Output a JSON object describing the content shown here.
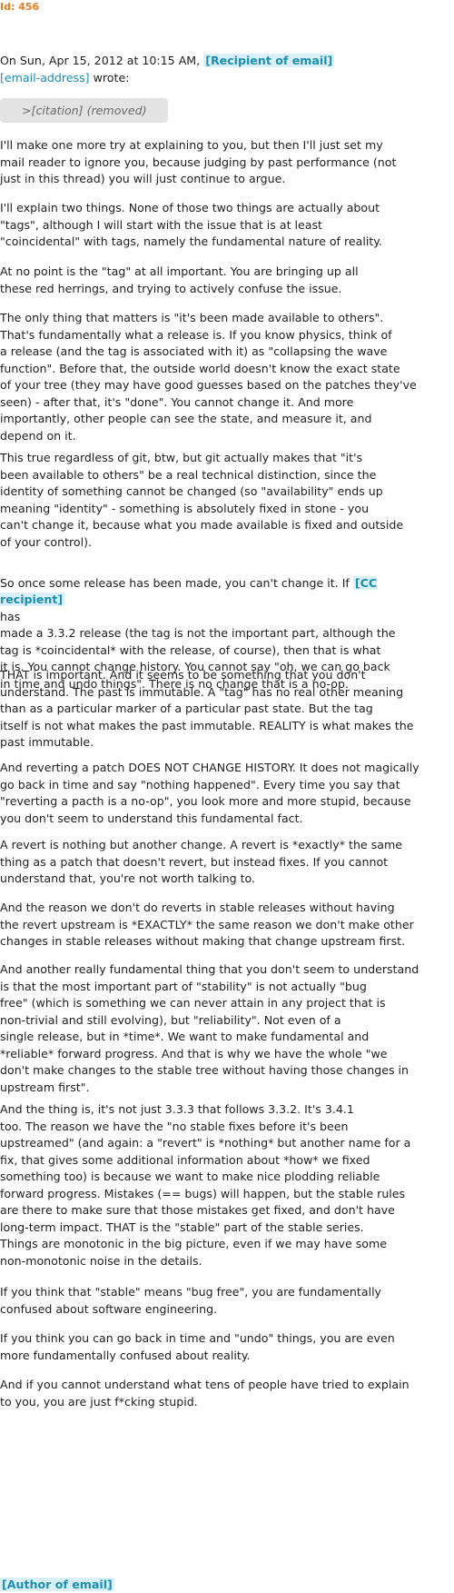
{
  "header": {
    "id_label": "Id: 456"
  },
  "intro": {
    "prefix": "On Sun, Apr 15, 2012 at 10:15 AM,",
    "recipient": "[Recipient of email]",
    "email": "[email-address]",
    "suffix": " wrote:"
  },
  "citation": ">[citation] (removed)",
  "paragraphs": [
    "I'll make one more try at explaining to you, but then I'll just set my\nmail reader to ignore you, because judging by past performance (not\njust in this thread) you will just continue to argue.",
    "I'll explain two things. None of those two things are actually about\n\"tags\", although I will start with the issue that is at least\n\"coincidental\" with tags, namely the fundamental nature of reality.",
    "At no point is the \"tag\" at all important. You are bringing up all\nthese red herrings, and trying to actively confuse the issue.",
    "The only thing that matters is \"it's been made available to others\".\nThat's fundamentally what a release is. If you know physics, think of\na release (and the tag is associated with it) as \"collapsing the wave\nfunction\". Before that, the outside world doesn't know the exact state\nof your tree (they may have good guesses based on the patches they've\nseen) - after that, it's \"done\". You cannot change it. And more\nimportantly, other people can see the state, and measure it, and\ndepend on it.",
    "This true regardless of git, btw, but git actually makes that \"it's\nbeen available to others\" be a real technical distinction, since the\nidentity of something cannot be changed (so \"availability\" ends up\nmeaning \"identity\" - something is absolutely fixed in stone - you\ncan't change it, because what you made available is fixed and outside\nof your control).",
    {
      "before": "So once some release has been made, you can't change it. If ",
      "tag": "[CC recipient]",
      "after": "\nhas\nmade a 3.3.2 release (the tag is not the important part, although the\ntag is *coincidental* with the release, of course), then that is what\nit is. You cannot change history. You cannot say \"oh, we can go back\nin time and undo things\". There is no change that is a no-op."
    },
    "THAT is important. And it seems to be something that you don't\nunderstand. The past is immutable. A \"tag\" has no real other meaning\nthan as a particular marker of a particular past state. But the tag\nitself is not what makes the past immutable. REALITY is what makes the\npast immutable.",
    "And reverting a patch DOES NOT CHANGE HISTORY. It does not magically\ngo back in time and say \"nothing happened\". Every time you say that\n\"reverting a pacth is a no-op\", you look more and more stupid, because\nyou don't seem to understand this fundamental fact.",
    "A revert is nothing but another change. A revert is *exactly* the same\nthing as a patch that doesn't revert, but instead fixes. If you cannot\nunderstand that, you're not worth talking to.",
    "And the reason we don't do reverts in stable releases without having\nthe revert upstream is *EXACTLY* the same reason we don't make other\nchanges in stable releases without making that change upstream first.",
    "And another really fundamental thing that you don't seem to understand\nis that the most important part of \"stability\" is not actually \"bug\nfree\" (which is something we can never attain in any project that is\nnon-trivial and still evolving), but \"reliability\". Not even of a\nsingle release, but in *time*. We want to make fundamental and\n*reliable* forward progress. And that is why we have the whole \"we\ndon't make changes to the stable tree without having those changes in\nupstream first\".",
    "And the thing is, it's not just 3.3.3 that follows 3.3.2. It's 3.4.1\ntoo. The reason we have the \"no stable fixes before it's been\nupstreamed\" (and again: a \"revert\" is *nothing* but another name for a\nfix, that gives some additional information about *how* we fixed\nsomething too) is because we want to make nice plodding reliable\nforward progress. Mistakes (== bugs) will happen, but the stable rules\nare there to make sure that those mistakes get fixed, and don't have\nlong-term impact. THAT is the \"stable\" part of the stable series.\nThings are monotonic in the big picture, even if we may have some\nnon-monotonic noise in the details.",
    "If you think that \"stable\" means \"bug free\", you are fundamentally\nconfused about software engineering.",
    "If you think you can go back in time and \"undo\" things, you are even\nmore fundamentally confused about reality.",
    "And if you cannot understand what tens of people have tried to explain\nto you, you are just f*cking stupid."
  ],
  "signature": "[Author of email]"
}
